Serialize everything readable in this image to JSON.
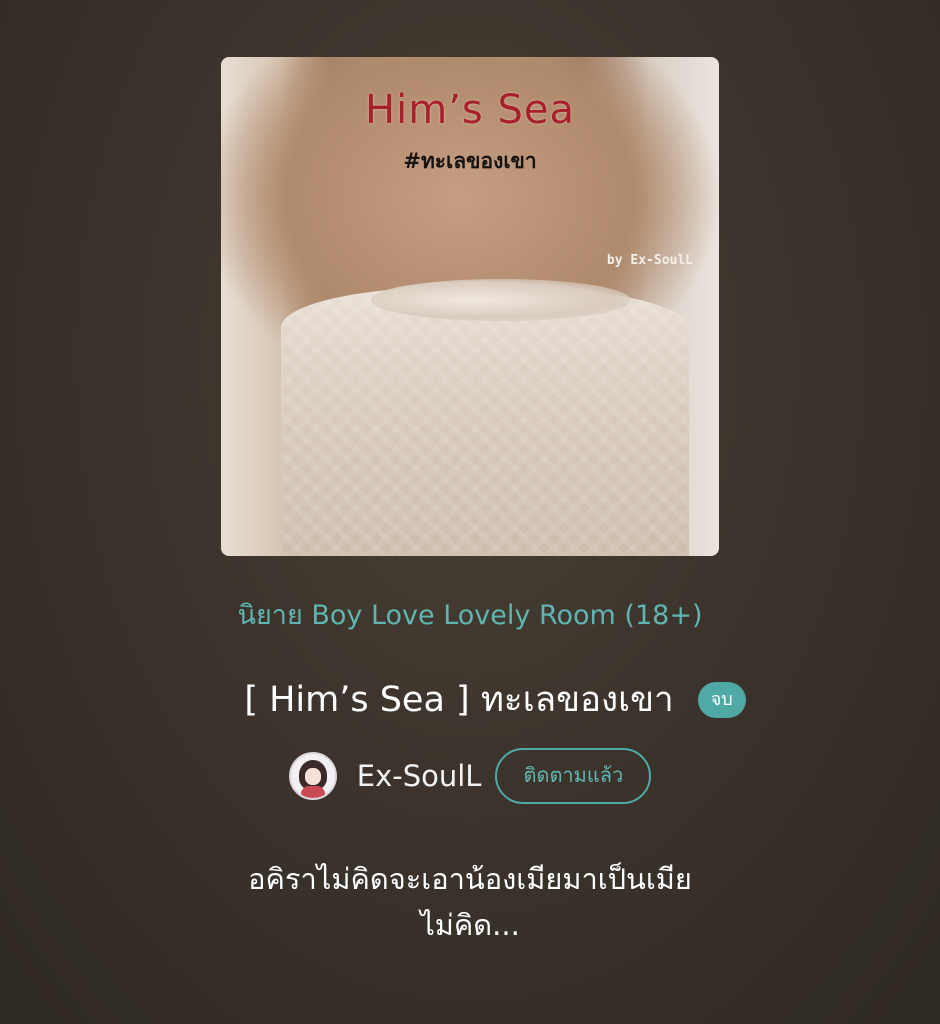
{
  "cover": {
    "title": "Him’s Sea",
    "hashtag": "#ทะเลของเขา",
    "byline": "by Ex-SoulL"
  },
  "category": "นิยาย Boy Love Lovely Room (18+)",
  "story": {
    "title": "[ Him’s Sea ] ทะเลของเขา",
    "status": "จบ"
  },
  "author": {
    "name": "Ex-SoulL",
    "follow_label": "ติดตามแล้ว"
  },
  "synopsis": {
    "line1": "อคิราไม่คิดจะเอาน้องเมียมาเป็นเมีย",
    "line2": "ไม่คิด..."
  },
  "colors": {
    "accent": "#4faaa5",
    "background": "#3c342c"
  }
}
